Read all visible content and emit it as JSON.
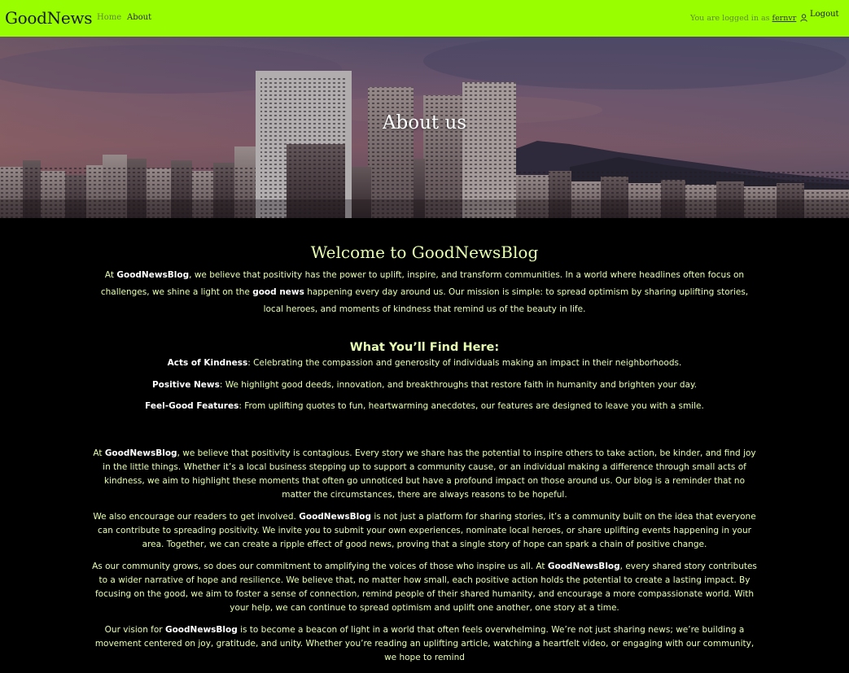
{
  "nav": {
    "brand": "GoodNews",
    "links": [
      "Home",
      "About"
    ],
    "logged_in_prefix": "You are logged in as",
    "username": "fernvr",
    "logout": "Logout"
  },
  "hero": {
    "title": "About us"
  },
  "welcome": {
    "title": "Welcome to GoodNewsBlog",
    "intro": {
      "s1": "At ",
      "b1": "GoodNewsBlog",
      "s2": ", we believe that positivity has the power to uplift, inspire, and transform communities. In a world where headlines often focus on challenges, we shine a light on the ",
      "b2": "good news",
      "s3": " happening every day around us. Our mission is simple: to spread optimism by sharing uplifting stories, local heroes, and moments of kindness that remind us of the beauty in life."
    }
  },
  "find": {
    "title": "What You’ll Find Here:",
    "items": [
      {
        "label": "Acts of Kindness",
        "text": ": Celebrating the compassion and generosity of individuals making an impact in their neighborhoods."
      },
      {
        "label": "Positive News",
        "text": ": We highlight good deeds, innovation, and breakthroughs that restore faith in humanity and brighten your day."
      },
      {
        "label": "Feel-Good Features",
        "text": ": From uplifting quotes to fun, heartwarming anecdotes, our features are designed to leave you with a smile."
      }
    ]
  },
  "paragraphs": [
    {
      "s1": "At ",
      "b": "GoodNewsBlog",
      "s2": ", we believe that positivity is contagious. Every story we share has the potential to inspire others to take action, be kinder, and find joy in the little things. Whether it’s a local business stepping up to support a community cause, or an individual making a difference through small acts of kindness, we aim to highlight these moments that often go unnoticed but have a profound impact on those around us. Our blog is a reminder that no matter the circumstances, there are always reasons to be hopeful."
    },
    {
      "s1": "We also encourage our readers to get involved. ",
      "b": "GoodNewsBlog",
      "s2": " is not just a platform for sharing stories, it’s a community built on the idea that everyone can contribute to spreading positivity. We invite you to submit your own experiences, nominate local heroes, or share uplifting events happening in your area. Together, we can create a ripple effect of good news, proving that a single story of hope can spark a chain of positive change."
    },
    {
      "s1": "As our community grows, so does our commitment to amplifying the voices of those who inspire us all. At ",
      "b": "GoodNewsBlog",
      "s2": ", every shared story contributes to a wider narrative of hope and resilience. We believe that, no matter how small, each positive action holds the potential to create a lasting impact. By focusing on the good, we aim to foster a sense of connection, remind people of their shared humanity, and encourage a more compassionate world. With your help, we can continue to spread optimism and uplift one another, one story at a time."
    },
    {
      "s1": "Our vision for ",
      "b": "GoodNewsBlog",
      "s2": " is to become a beacon of light in a world that often feels overwhelming. We’re not just sharing news; we’re building a movement centered on joy, gratitude, and unity. Whether you’re reading an uplifting article, watching a heartfelt video, or engaging with our community, we hope to remind"
    }
  ],
  "colors": {
    "navbar_bg": "#99ff00",
    "page_bg": "#000000",
    "text": "#e8ffb0"
  }
}
